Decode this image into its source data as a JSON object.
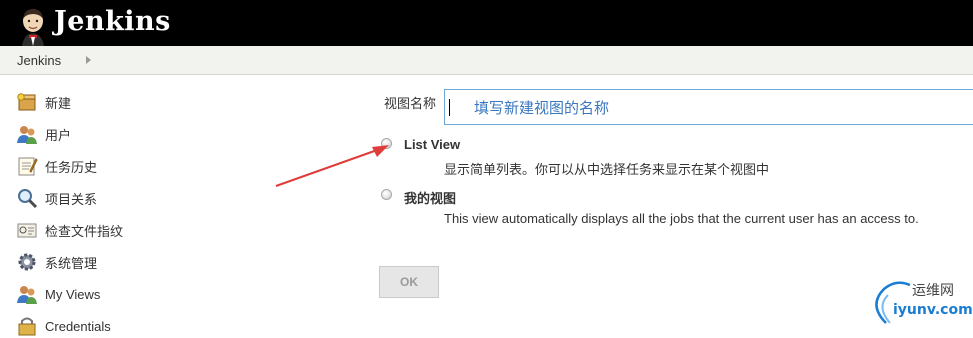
{
  "header": {
    "title": "Jenkins"
  },
  "breadcrumb": {
    "items": [
      "Jenkins"
    ]
  },
  "sidebar": {
    "items": [
      {
        "label": "新建",
        "icon": "new-package-icon"
      },
      {
        "label": "用户",
        "icon": "users-icon"
      },
      {
        "label": "任务历史",
        "icon": "notepad-icon"
      },
      {
        "label": "项目关系",
        "icon": "magnifier-icon"
      },
      {
        "label": "检查文件指纹",
        "icon": "fingerprint-icon"
      },
      {
        "label": "系统管理",
        "icon": "gear-icon"
      },
      {
        "label": "My Views",
        "icon": "users-icon"
      },
      {
        "label": "Credentials",
        "icon": "credentials-icon"
      }
    ]
  },
  "form": {
    "name_label": "视图名称",
    "name_value": "",
    "name_hint": "填写新建视图的名称",
    "options": [
      {
        "title": "List View",
        "description": "显示简单列表。你可以从中选择任务来显示在某个视图中"
      },
      {
        "title": "我的视图",
        "description": "This view automatically displays all the jobs that the current user has an access to."
      }
    ],
    "ok_label": "OK"
  },
  "watermark": {
    "top_text": "运维网",
    "bottom_text": "iyunv.com"
  },
  "colors": {
    "accent_blue": "#3a78bf",
    "annotation_red": "#e03c3c",
    "topbar": "#000000"
  }
}
